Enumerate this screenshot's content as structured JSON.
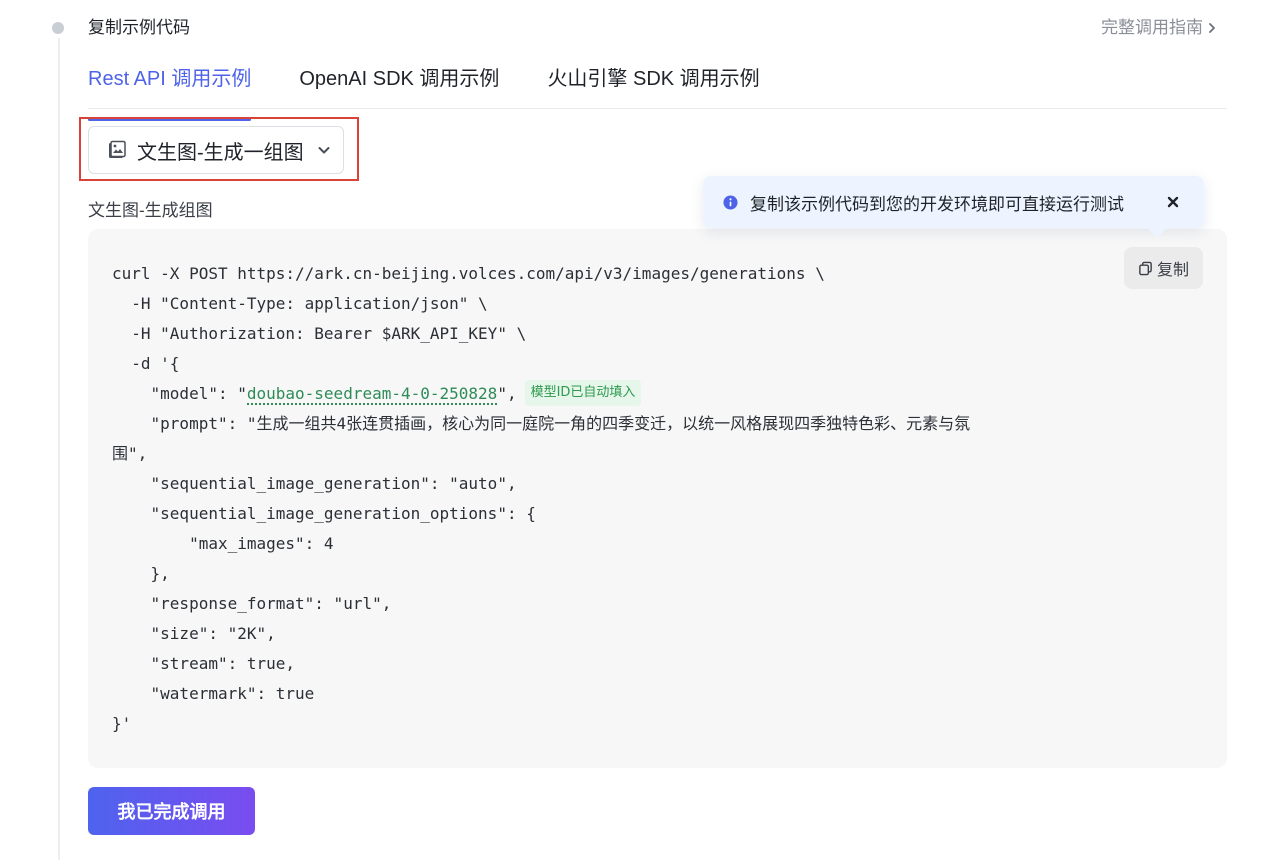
{
  "step": {
    "title": "复制示例代码",
    "guide_link": "完整调用指南"
  },
  "tabs": [
    {
      "label": "Rest API 调用示例",
      "active": true
    },
    {
      "label": "OpenAI SDK 调用示例",
      "active": false
    },
    {
      "label": "火山引擎 SDK 调用示例",
      "active": false
    }
  ],
  "selector": {
    "value": "文生图-生成一组图"
  },
  "sample_label": "文生图-生成组图",
  "tooltip": {
    "message": "复制该示例代码到您的开发环境即可直接运行测试"
  },
  "copy_label": "复制",
  "code": {
    "line1": "curl -X POST https://ark.cn-beijing.volces.com/api/v3/images/generations \\",
    "line2": "  -H \"Content-Type: application/json\" \\",
    "line3": "  -H \"Authorization: Bearer $ARK_API_KEY\" \\",
    "line4": "  -d '{",
    "model_prefix": "    \"model\": \"",
    "model_value": "doubao-seedream-4-0-250828",
    "model_suffix": "\",",
    "model_hint": "模型ID已自动填入",
    "prompt_line1": "    \"prompt\": \"生成一组共4张连贯插画，核心为同一庭院一角的四季变迁，以统一风格展现四季独特色彩、元素与氛",
    "prompt_line2": "围\",",
    "line7": "    \"sequential_image_generation\": \"auto\",",
    "line8": "    \"sequential_image_generation_options\": {",
    "line9": "        \"max_images\": 4",
    "line10": "    },",
    "line11": "    \"response_format\": \"url\",",
    "line12": "    \"size\": \"2K\",",
    "line13": "    \"stream\": true,",
    "line14": "    \"watermark\": true",
    "line15": "}'"
  },
  "done_button": "我已完成调用",
  "colors": {
    "accent": "#4e63e8",
    "highlight_border": "#d9433a",
    "model_green": "#2e8b57"
  }
}
